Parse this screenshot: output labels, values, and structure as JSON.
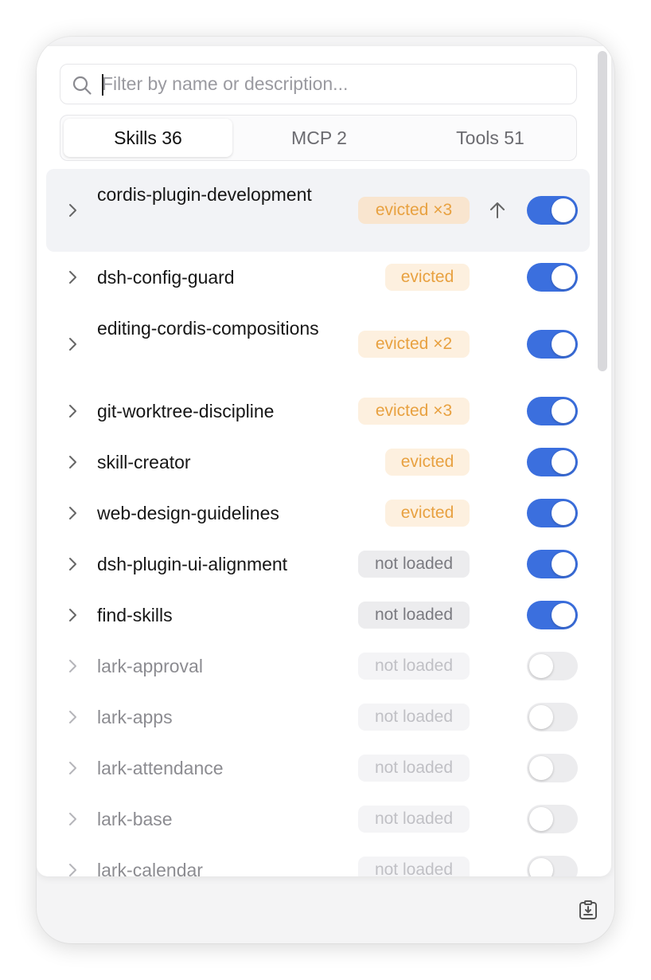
{
  "search": {
    "placeholder": "Filter by name or description..."
  },
  "tabs": [
    {
      "label": "Skills 36",
      "active": true
    },
    {
      "label": "MCP 2",
      "active": false
    },
    {
      "label": "Tools 51",
      "active": false
    }
  ],
  "skills": [
    {
      "name": "cordis-plugin-development",
      "badge": "evicted ×3",
      "badge_type": "evicted",
      "enabled": true,
      "highlighted": true,
      "has_up": true
    },
    {
      "name": "dsh-config-guard",
      "badge": "evicted",
      "badge_type": "evicted",
      "enabled": true
    },
    {
      "name": "editing-cordis-compositions",
      "badge": "evicted ×2",
      "badge_type": "evicted",
      "enabled": true
    },
    {
      "name": "git-worktree-discipline",
      "badge": "evicted ×3",
      "badge_type": "evicted",
      "enabled": true
    },
    {
      "name": "skill-creator",
      "badge": "evicted",
      "badge_type": "evicted",
      "enabled": true
    },
    {
      "name": "web-design-guidelines",
      "badge": "evicted",
      "badge_type": "evicted",
      "enabled": true
    },
    {
      "name": "dsh-plugin-ui-alignment",
      "badge": "not loaded",
      "badge_type": "notloaded",
      "enabled": true
    },
    {
      "name": "find-skills",
      "badge": "not loaded",
      "badge_type": "notloaded",
      "enabled": true
    },
    {
      "name": "lark-approval",
      "badge": "not loaded",
      "badge_type": "notloaded",
      "enabled": false
    },
    {
      "name": "lark-apps",
      "badge": "not loaded",
      "badge_type": "notloaded",
      "enabled": false
    },
    {
      "name": "lark-attendance",
      "badge": "not loaded",
      "badge_type": "notloaded",
      "enabled": false
    },
    {
      "name": "lark-base",
      "badge": "not loaded",
      "badge_type": "notloaded",
      "enabled": false
    },
    {
      "name": "lark-calendar",
      "badge": "not loaded",
      "badge_type": "notloaded",
      "enabled": false
    }
  ],
  "colors": {
    "accent": "#3b6fde",
    "evicted_text": "#e8a140",
    "evicted_bg": "#fdf0df"
  },
  "icons": {
    "search": "search-icon",
    "expand": "chevron-right-icon",
    "move_up": "arrow-up-icon",
    "footer": "clipboard-download-icon"
  }
}
